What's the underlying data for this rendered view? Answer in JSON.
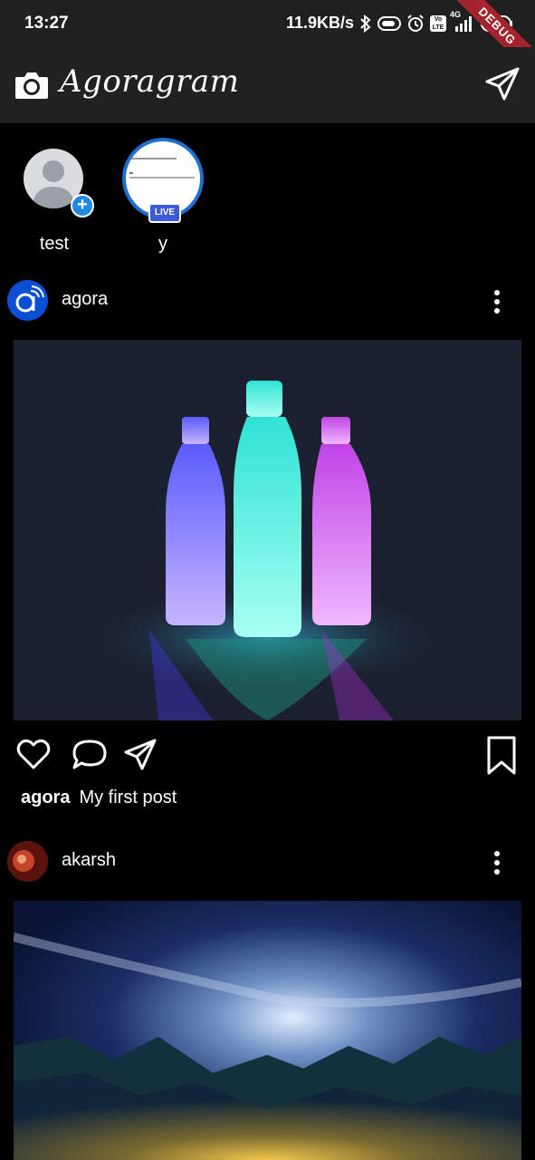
{
  "status_bar": {
    "time": "13:27",
    "net_speed": "11.9KB/s",
    "network_label": "4G",
    "volte_label": "Vo LTE",
    "debug_label": "DEBUG"
  },
  "app_bar": {
    "title": "Agoragram",
    "left_icon": "camera-icon",
    "right_icon": "send-icon"
  },
  "stories": [
    {
      "label": "test",
      "type": "add-story"
    },
    {
      "label": "y",
      "type": "live",
      "badge": "LIVE"
    }
  ],
  "posts": [
    {
      "username": "agora",
      "caption_user": "agora",
      "caption_text": "My first post",
      "image": "glowing-bottles"
    },
    {
      "username": "akarsh",
      "image": "night-sky-mountains"
    }
  ],
  "colors": {
    "background": "#000000",
    "app_bar": "#212121",
    "accent_blue": "#1e88e5",
    "live_badge": "#3b5bdb",
    "debug_banner": "#a3242c"
  }
}
